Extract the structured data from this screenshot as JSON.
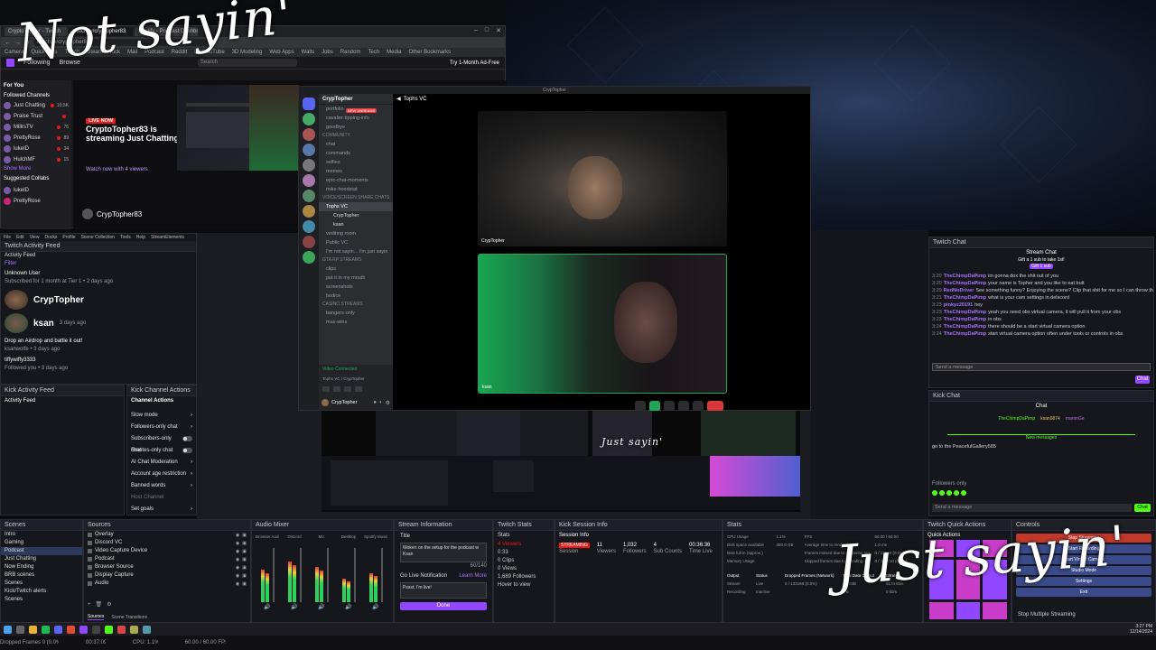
{
  "overlay": {
    "top_left": "Not sayin'",
    "bottom_right": "Just sayin'",
    "preview_small": "Just sayin'"
  },
  "browser": {
    "tabs": [
      "CryptoTopher - Twitch",
      "twitch.tv/cryptopher83",
      "Spotify - Podcast Dashboard"
    ],
    "url": "twitch.tv/cryptopher83",
    "bookmarks": [
      "Camera",
      "Quick links",
      "Twitch",
      "Steam",
      "Kick",
      "Mail",
      "Podcast",
      "Reddit",
      "PC/YouTube",
      "3D Modeling",
      "Web Apps",
      "Walls",
      "Jobs",
      "Random",
      "Tech",
      "Media",
      "Other Bookmarks"
    ],
    "nav": [
      "Following",
      "Browse"
    ],
    "search_placeholder": "Search",
    "cta": "Try 1-Month Ad-Free",
    "sidebar_header": "For You",
    "followed_label": "Followed Channels",
    "channels": [
      {
        "name": "Just Chatting",
        "viewers": "10.5K"
      },
      {
        "name": "Praise Trust",
        "viewers": ""
      },
      {
        "name": "MillrsTV",
        "viewers": "76"
      },
      {
        "name": "PrettyRose",
        "viewers": "89"
      },
      {
        "name": "lukeID",
        "viewers": "34"
      },
      {
        "name": "HulchMF",
        "viewers": "15"
      }
    ],
    "show_more": "Show More",
    "suggested": "Suggested Collabs",
    "suggested_channels": [
      "lukeID",
      "PrettyRose"
    ],
    "live_badge": "LIVE NOW",
    "stream_line1": "CryptoTopher83 is",
    "stream_line2": "streaming Just Chatting",
    "watch_now": "Watch now with 4 viewers",
    "channel_name": "CrypTopher83"
  },
  "discord": {
    "window_title": "CrypTopher",
    "server_name": "CrypTopher",
    "tooltip": "NEW UNREADS",
    "voice_channel": "Tophs VC",
    "channels_top": [
      "portfolio",
      "cavalier-tipping-info",
      "goodbye"
    ],
    "community_label": "Community",
    "community_channels": [
      "chat",
      "commands",
      "selfies",
      "memes",
      "epic-chat-moments",
      "mike-hoodstat"
    ],
    "voice_label": "Voice/Screen Share Chats",
    "voice_users": [
      "CrypTopher",
      "ksan"
    ],
    "voice_channels": [
      "vediting room",
      "Public VC",
      "I'm not sayin... I'm just sayin"
    ],
    "gta_label": "GTA RP Streams",
    "gta_channels": [
      "clips",
      "put it in my mouth",
      "screenshots",
      "bodice"
    ],
    "casino_label": "Casino Streams",
    "casino_channels": [
      "bangers-only",
      "max-wins"
    ],
    "connected": "Video Connected",
    "connected_sub": "Tophs VC / CrypTopher",
    "user_name": "CrypTopher",
    "user_status": "...",
    "video1_label": "CrypTopher",
    "video2_label": "ksan"
  },
  "twitch_chat": {
    "dock_title": "Twitch Chat",
    "header": "Stream Chat",
    "gift_banner": "Gift a 1 sub to take 1st!",
    "gift_button": "Gift 1 sub",
    "messages": [
      {
        "time": "3:20",
        "user": "TheChimpDaPimp",
        "text": "im gonna dox the shit out of you"
      },
      {
        "time": "3:20",
        "user": "TheChimpDaPimp",
        "text": "your name is Topher and you like to eat butt"
      },
      {
        "time": "3:20",
        "user": "RedNoDriver",
        "text": "See something funny? Enjoying the scene? Clip that shit for me so I can throw that on TikTok please! Thank you much!"
      },
      {
        "time": "3:21",
        "user": "TheChimpDaPimp",
        "text": "what is your cam settings in delscord"
      },
      {
        "time": "3:23",
        "user": "pinkyz20191",
        "text": "hey"
      },
      {
        "time": "3:23",
        "user": "TheChimpDaPimp",
        "text": "yeah you need obs virtual camera, it will pull it from your obs"
      },
      {
        "time": "3:23",
        "user": "TheChimpDaPimp",
        "text": "in obs"
      },
      {
        "time": "3:24",
        "user": "TheChimpDaPimp",
        "text": "there should be a start virtual camera option"
      },
      {
        "time": "3:24",
        "user": "TheChimpDaPimp",
        "text": "start virtual camera option often under tools or controls in obs"
      }
    ],
    "input_placeholder": "Send a message",
    "chat_button": "Chat"
  },
  "kick_chat": {
    "dock_title": "Kick Chat",
    "header": "Chat",
    "top_users": [
      "TheChimpDaPimp",
      "ksan9874",
      "maronGe"
    ],
    "new_messages": "New messages",
    "message": "go to the PeacefulGallery585",
    "followers_only": "Followers only",
    "input_placeholder": "Send a message",
    "chat_button": "Chat"
  },
  "activity": {
    "dock_title": "Twitch Activity Feed",
    "feed_label": "Activity Feed",
    "menu": [
      "File",
      "Edit",
      "View",
      "Docks",
      "Profile",
      "Scene Collection",
      "Tools",
      "Help",
      "StreamElements"
    ],
    "filter": "Filter",
    "items": [
      {
        "user": "Unknown User",
        "text": "Subscribed for 1 month at Tier 1",
        "time": "2 days ago"
      },
      {
        "user": "CrypTopher",
        "text": "",
        "time": ""
      },
      {
        "user": "ksan",
        "text": "",
        "time": "3 days ago"
      },
      {
        "user": "",
        "text": "Drop an Airdrop and battle it out!",
        "time": ""
      },
      {
        "user": "",
        "text": "ksanwolfe",
        "time": "3 days ago"
      },
      {
        "user": "tiffywiffy3333",
        "text": "Followed you",
        "time": "3 days ago"
      }
    ]
  },
  "kick_activity": {
    "dock_title": "Kick Activity Feed",
    "label": "Activity Feed"
  },
  "kick_channel": {
    "dock_title": "Kick Channel Actions",
    "header": "Channel Actions",
    "items": [
      {
        "label": "Slow mode",
        "control": "arrow"
      },
      {
        "label": "Followers-only chat",
        "control": "arrow"
      },
      {
        "label": "Subscribers-only chat",
        "control": "toggle"
      },
      {
        "label": "Emotes-only chat",
        "control": "toggle"
      },
      {
        "label": "AI Chat Moderation",
        "control": "arrow"
      },
      {
        "label": "Account age restriction",
        "control": "arrow"
      },
      {
        "label": "Banned words",
        "control": "arrow"
      },
      {
        "label": "Host Channel",
        "control": "none"
      },
      {
        "label": "Set goals",
        "control": "arrow"
      }
    ]
  },
  "scenes": {
    "dock_title": "Scenes",
    "items": [
      "Intro",
      "Gaming",
      "Podcast",
      "Just Chatting",
      "Now Ending",
      "BRB scenes",
      "Scenes",
      "Kick/Twitch alerts",
      "Scenes"
    ]
  },
  "sources": {
    "dock_title": "Sources",
    "items": [
      "Overlay",
      "Discord VC",
      "Video Capture Device",
      "Podcast",
      "Browser Source",
      "Display Capture",
      "Audio"
    ],
    "tabs": [
      "Sources",
      "Scene Transitions"
    ]
  },
  "mixer": {
    "dock_title": "Audio Mixer",
    "channels": [
      "Browser Audio",
      "Discord",
      "Mic",
      "Desktop",
      "Spotify Music"
    ]
  },
  "stream_info": {
    "dock_title": "Stream Information",
    "title_label": "Title",
    "title_value": "Woken on the setup for the podcast w Ksan",
    "char_count": "60/140",
    "notif_label": "Go Live Notification",
    "learn_more": "Learn More",
    "notif_value": "Pssst, I'm live!",
    "done": "Done"
  },
  "twitch_stats": {
    "dock_title": "Twitch Stats",
    "label": "Stats",
    "items": [
      "4 Viewers",
      "0:33",
      "0 Clips",
      "0 Views",
      "1,689 Followers",
      "Hover to view"
    ]
  },
  "kick_session": {
    "dock_title": "Kick Session Info",
    "label": "Session Info",
    "status": "STREAMING",
    "session": "Session",
    "viewers": "11",
    "viewers_label": "Viewers",
    "followers": "1,032",
    "followers_label": "Followers",
    "subs": "4",
    "subs_label": "Sub Counts",
    "time": "00:36:36",
    "time_label": "Time Live"
  },
  "stats": {
    "dock_title": "Stats",
    "rows": [
      [
        "CPU Usage",
        "1.1%",
        "FPS",
        "60.00 / 60.00"
      ],
      [
        "Disk space available",
        "380.6 GB",
        "Average time to render frame",
        "1.0 ms"
      ],
      [
        "Disk full in (approx.)",
        "",
        "Frames missed due to rendering lag",
        "0 / 13550 (0.0%)"
      ],
      [
        "Memory Usage",
        "",
        "Skipped frames due to encoding lag",
        "0 / 135710 (0.0%)"
      ]
    ],
    "output_headers": [
      "Output",
      "Status",
      "Dropped Frames (Network)",
      "Total Data Output",
      "Bitrate"
    ],
    "output_rows": [
      [
        "Stream",
        "Live",
        "0 / 133168 (0.0%)",
        "1.6 GiB",
        "6174 kb/s"
      ],
      [
        "Recording",
        "Inactive",
        "",
        "0 B",
        "0 kb/s"
      ]
    ]
  },
  "quick_actions": {
    "dock_title": "Twitch Quick Actions",
    "label": "Quick Actions"
  },
  "controls": {
    "dock_title": "Controls",
    "items": [
      "Stop Streaming",
      "Start Recording",
      "Start Virtual Camera",
      "Studio Mode",
      "Settings",
      "Exit"
    ],
    "footer": "Stop Multiple Streaming"
  },
  "status_bar": {
    "dropped": "Dropped Frames 0 (0.0%)",
    "time": "00:37:09",
    "cpu": "CPU: 1.1%",
    "fps": "60.00 / 60.00 FPS",
    "clock": "3:27 PM",
    "date": "12/14/2024"
  },
  "colors": {
    "twitch": "#9147ff",
    "kick": "#53fc18",
    "discord": "#5865f2",
    "live_red": "#e91916"
  }
}
